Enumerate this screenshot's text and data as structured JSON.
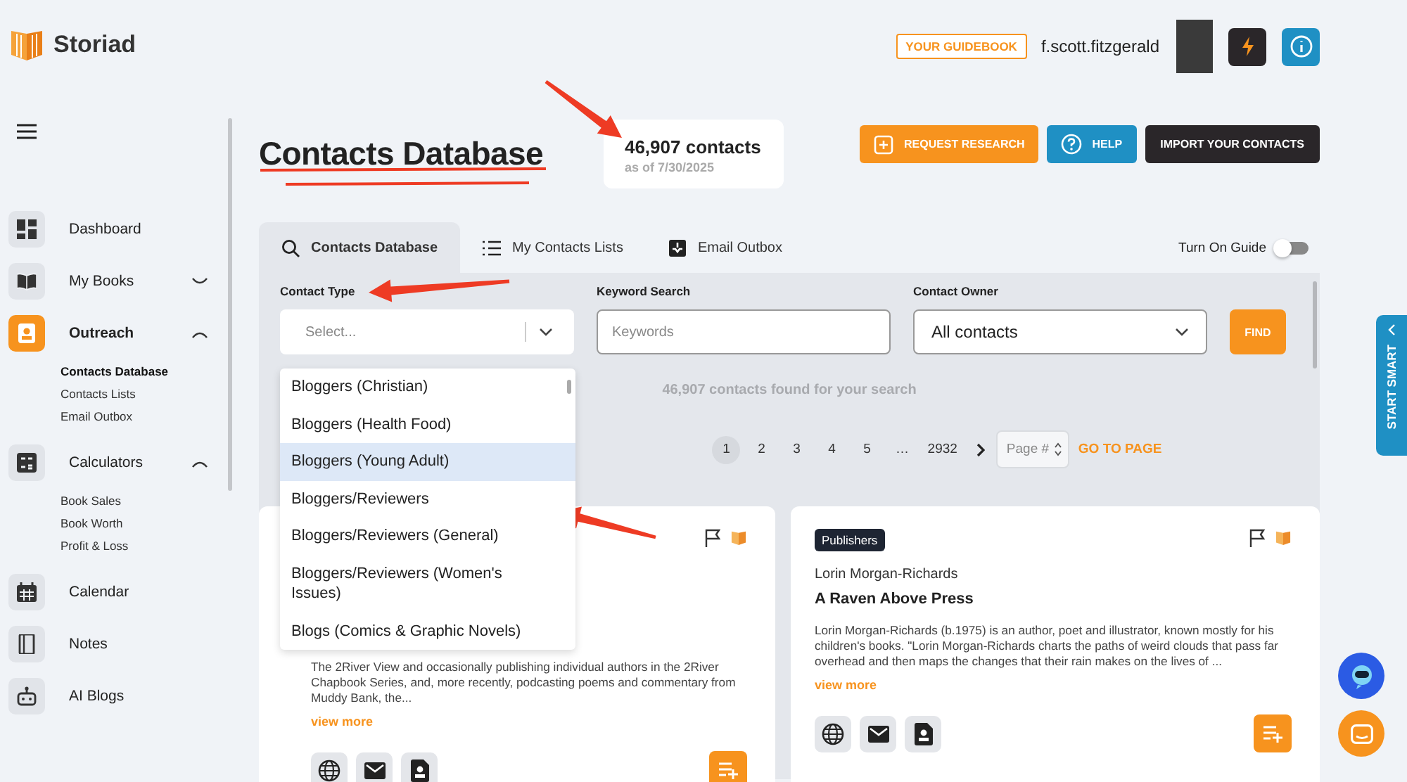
{
  "brand": {
    "name": "Storiad"
  },
  "header": {
    "guidebook": "YOUR GUIDEBOOK",
    "username": "f.scott.fitzgerald"
  },
  "sidebar": {
    "items": [
      {
        "label": "Dashboard",
        "kind": "link",
        "selected": false
      },
      {
        "label": "My Books",
        "kind": "group",
        "selected": false,
        "expanded": false
      },
      {
        "label": "Outreach",
        "kind": "group",
        "selected": true,
        "expanded": true,
        "children": [
          {
            "label": "Contacts Database",
            "selected": true
          },
          {
            "label": "Contacts Lists",
            "selected": false
          },
          {
            "label": "Email Outbox",
            "selected": false
          }
        ]
      },
      {
        "label": "Calculators",
        "kind": "group",
        "selected": false,
        "expanded": true,
        "children": [
          {
            "label": "Book Sales",
            "selected": false
          },
          {
            "label": "Book Worth",
            "selected": false
          },
          {
            "label": "Profit & Loss",
            "selected": false
          }
        ]
      },
      {
        "label": "Calendar",
        "kind": "link",
        "selected": false
      },
      {
        "label": "Notes",
        "kind": "link",
        "selected": false
      },
      {
        "label": "AI Blogs",
        "kind": "link",
        "selected": false
      }
    ]
  },
  "title": "Contacts Database",
  "total": {
    "count": "46,907 contacts",
    "as_of": "as of 7/30/2025"
  },
  "actions": [
    {
      "label": "REQUEST RESEARCH",
      "kind": "research"
    },
    {
      "label": "HELP",
      "kind": "help"
    },
    {
      "label": "IMPORT YOUR CONTACTS",
      "kind": "import"
    }
  ],
  "tabs": [
    {
      "label": "Contacts Database",
      "selected": true
    },
    {
      "label": "My Contacts Lists",
      "selected": false
    },
    {
      "label": "Email Outbox",
      "selected": false
    }
  ],
  "guide_toggle": {
    "label": "Turn On Guide",
    "on": false
  },
  "filters": {
    "contact_type": {
      "label": "Contact Type",
      "placeholder": "Select...",
      "expanded": true,
      "options": [
        {
          "label": "Bloggers (Christian)",
          "selected": false
        },
        {
          "label": "Bloggers (Health Food)",
          "selected": false
        },
        {
          "label": "Bloggers (Young Adult)",
          "selected": true
        },
        {
          "label": "Bloggers/Reviewers",
          "selected": false
        },
        {
          "label": "Bloggers/Reviewers (General)",
          "selected": false
        },
        {
          "label": "Bloggers/Reviewers (Women's Issues)",
          "selected": false
        },
        {
          "label": "Blogs (Comics & Graphic Novels)",
          "selected": false
        }
      ]
    },
    "keyword": {
      "label": "Keyword Search",
      "placeholder": "Keywords"
    },
    "owner": {
      "label": "Contact Owner",
      "value": "All contacts"
    },
    "find": "FIND"
  },
  "results_text": "46,907 contacts found for your search",
  "pagination": {
    "pages": [
      {
        "label": "1",
        "selected": true
      },
      {
        "label": "2",
        "selected": false
      },
      {
        "label": "3",
        "selected": false
      },
      {
        "label": "4",
        "selected": false
      },
      {
        "label": "5",
        "selected": false
      },
      {
        "label": "…",
        "selected": false
      },
      {
        "label": "2932",
        "selected": false
      }
    ],
    "page_input": {
      "placeholder": "Page #"
    },
    "go": "GO TO PAGE"
  },
  "cards": [
    {
      "description": "The 2River View and occasionally publishing individual authors in the 2River Chapbook Series, and, more recently, podcasting poems and commentary from Muddy Bank, the...",
      "link": "view more"
    },
    {
      "tag": "Publishers",
      "contact": "Lorin Morgan-Richards",
      "organization": "A Raven Above Press",
      "description": "Lorin Morgan-Richards (b.1975) is an author, poet and illustrator, known mostly for his children's books. \"Lorin Morgan-Richards charts the paths of weird clouds that pass far overhead and then maps the changes that their rain makes on the lives of ...",
      "link": "view more"
    }
  ],
  "start_smart": "START SMART",
  "annotations": [
    {
      "kind": "arrow"
    },
    {
      "kind": "underline"
    },
    {
      "kind": "arrow"
    },
    {
      "kind": "arrow"
    }
  ]
}
